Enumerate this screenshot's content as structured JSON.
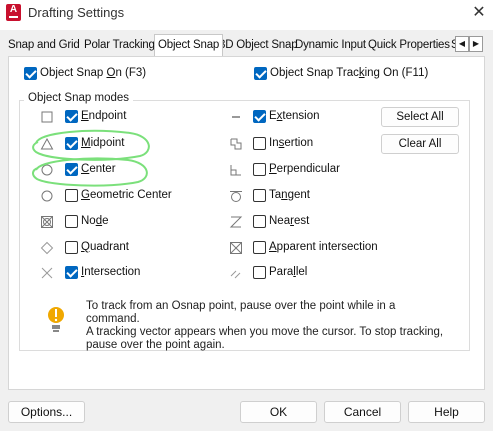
{
  "window": {
    "title": "Drafting Settings"
  },
  "tabs": [
    {
      "label": "Snap and Grid"
    },
    {
      "label": "Polar Tracking"
    },
    {
      "label": "Object Snap"
    },
    {
      "label": "3D Object Snap"
    },
    {
      "label": "Dynamic Input"
    },
    {
      "label": "Quick Properties"
    },
    {
      "label": "S"
    }
  ],
  "top_options": {
    "osnap_on": {
      "label_pre": "Object Snap ",
      "label_u": "O",
      "label_post": "n (F3)",
      "checked": true
    },
    "osnap_tracking": {
      "label_pre": "Object Snap Trac",
      "label_u": "k",
      "label_post": "ing On (F11)",
      "checked": true
    }
  },
  "modes_title": "Object Snap modes",
  "left_modes": [
    {
      "pre": "",
      "u": "E",
      "post": "ndpoint",
      "checked": true,
      "icon": "endpoint-icon"
    },
    {
      "pre": "",
      "u": "M",
      "post": "idpoint",
      "checked": true,
      "icon": "midpoint-icon"
    },
    {
      "pre": "",
      "u": "C",
      "post": "enter",
      "checked": true,
      "icon": "center-icon"
    },
    {
      "pre": "",
      "u": "G",
      "post": "eometric Center",
      "checked": false,
      "icon": "geometric-center-icon"
    },
    {
      "pre": "No",
      "u": "d",
      "post": "e",
      "checked": false,
      "icon": "node-icon"
    },
    {
      "pre": "",
      "u": "Q",
      "post": "uadrant",
      "checked": false,
      "icon": "quadrant-icon"
    },
    {
      "pre": "",
      "u": "I",
      "post": "ntersection",
      "checked": true,
      "icon": "intersection-icon"
    }
  ],
  "right_modes": [
    {
      "pre": "E",
      "u": "x",
      "post": "tension",
      "checked": true,
      "icon": "extension-icon"
    },
    {
      "pre": "In",
      "u": "s",
      "post": "ertion",
      "checked": false,
      "icon": "insertion-icon"
    },
    {
      "pre": "",
      "u": "P",
      "post": "erpendicular",
      "checked": false,
      "icon": "perpendicular-icon"
    },
    {
      "pre": "Ta",
      "u": "n",
      "post": "gent",
      "checked": false,
      "icon": "tangent-icon"
    },
    {
      "pre": "Nea",
      "u": "r",
      "post": "est",
      "checked": false,
      "icon": "nearest-icon"
    },
    {
      "pre": "",
      "u": "A",
      "post": "pparent intersection",
      "checked": false,
      "icon": "apparent-intersection-icon"
    },
    {
      "pre": "Para",
      "u": "l",
      "post": "lel",
      "checked": false,
      "icon": "parallel-icon"
    }
  ],
  "buttons": {
    "select_all": "Select All",
    "clear_all": "Clear All"
  },
  "info": {
    "line1": "To track from an Osnap point, pause over the point while in a command.",
    "line2": "A tracking vector appears when you move the cursor.  To stop tracking,",
    "line3": "pause over the point again."
  },
  "footer": {
    "options": "Options...",
    "ok": "OK",
    "cancel": "Cancel",
    "help": "Help"
  },
  "colors": {
    "accent": "#0067c0",
    "brand": "#c8102e",
    "annotation": "#7be07b"
  }
}
